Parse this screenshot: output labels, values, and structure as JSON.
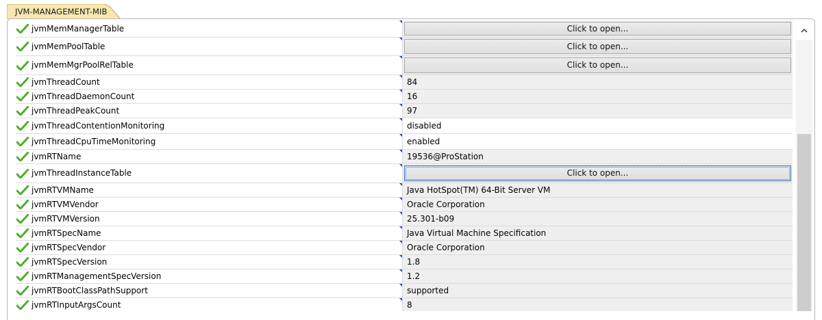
{
  "tab": {
    "title": "JVM-MANAGEMENT-MIB"
  },
  "rows": [
    {
      "name": "jvmMemManagerTable",
      "value": "Click to open...",
      "kind": "button"
    },
    {
      "name": "jvmMemPoolTable",
      "value": "Click to open...",
      "kind": "button"
    },
    {
      "name": "jvmMemMgrPoolRelTable",
      "value": "Click to open...",
      "kind": "button"
    },
    {
      "name": "jvmThreadCount",
      "value": "84",
      "kind": "text"
    },
    {
      "name": "jvmThreadDaemonCount",
      "value": "16",
      "kind": "text"
    },
    {
      "name": "jvmThreadPeakCount",
      "value": "97",
      "kind": "text"
    },
    {
      "name": "jvmThreadContentionMonitoring",
      "value": "disabled",
      "kind": "editable"
    },
    {
      "name": "jvmThreadCpuTimeMonitoring",
      "value": "enabled",
      "kind": "editable"
    },
    {
      "name": "jvmRTName",
      "value": "19536@ProStation",
      "kind": "text"
    },
    {
      "name": "jvmThreadInstanceTable",
      "value": "Click to open...",
      "kind": "button",
      "focused": true
    },
    {
      "name": "jvmRTVMName",
      "value": "Java HotSpot(TM) 64-Bit Server VM",
      "kind": "text"
    },
    {
      "name": "jvmRTVMVendor",
      "value": "Oracle Corporation",
      "kind": "text"
    },
    {
      "name": "jvmRTVMVersion",
      "value": "25.301-b09",
      "kind": "text"
    },
    {
      "name": "jvmRTSpecName",
      "value": "Java Virtual Machine Specification",
      "kind": "text"
    },
    {
      "name": "jvmRTSpecVendor",
      "value": "Oracle Corporation",
      "kind": "text"
    },
    {
      "name": "jvmRTSpecVersion",
      "value": "1.8",
      "kind": "text"
    },
    {
      "name": "jvmRTManagementSpecVersion",
      "value": "1.2",
      "kind": "text"
    },
    {
      "name": "jvmRTBootClassPathSupport",
      "value": "supported",
      "kind": "text"
    },
    {
      "name": "jvmRTInputArgsCount",
      "value": "8",
      "kind": "text"
    }
  ],
  "icons": {
    "row_status": "checkmark-icon",
    "scroll_up": "chevron-up-icon"
  },
  "colors": {
    "check": "#4caf2a",
    "tab": "#f7e7b0",
    "corner_marker": "#1d4fb0"
  }
}
